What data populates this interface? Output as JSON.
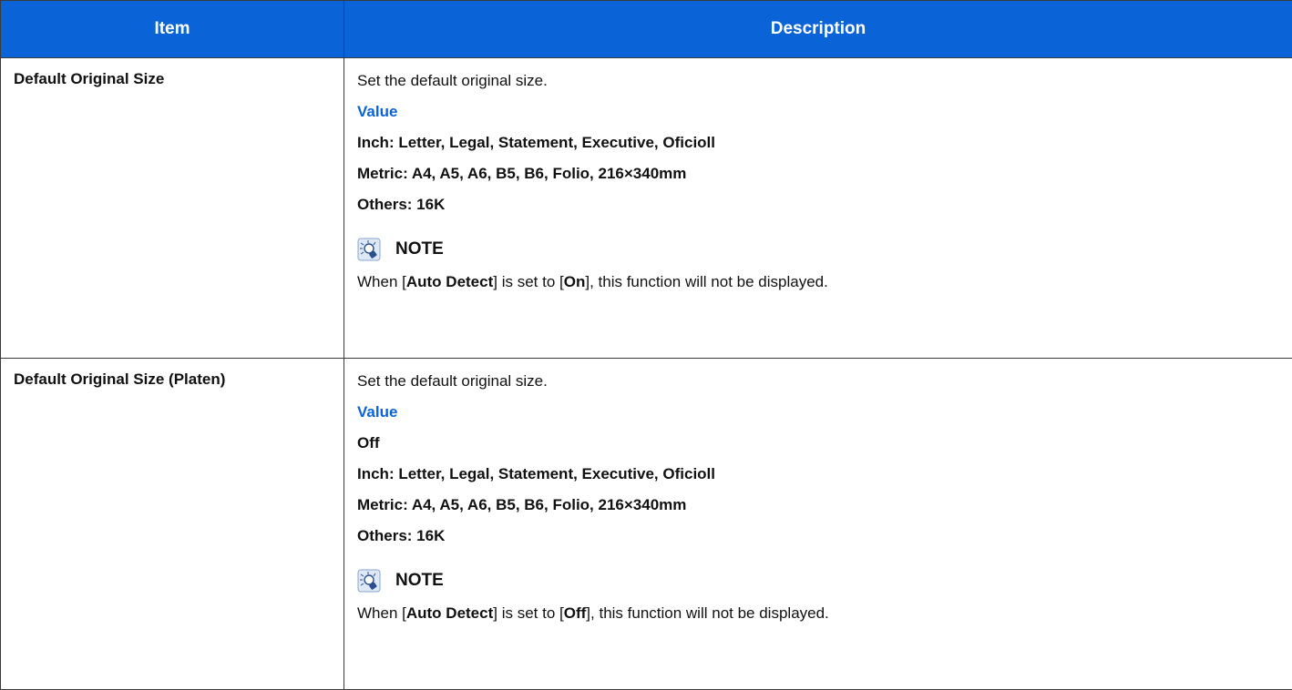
{
  "table": {
    "headers": {
      "item": "Item",
      "description": "Description"
    },
    "rows": [
      {
        "item": "Default Original Size",
        "intro": "Set the default original size.",
        "value_heading": "Value",
        "values": [
          "Inch: Letter, Legal, Statement, Executive, Oficioll",
          "Metric: A4, A5, A6, B5, B6, Folio, 216×340mm",
          "Others: 16K"
        ],
        "note_label": "NOTE",
        "note": {
          "pre": "When [",
          "key": "Auto Detect",
          "mid": "] is set to [",
          "state": "On",
          "post": "], this function will not be displayed."
        }
      },
      {
        "item": "Default Original Size (Platen)",
        "intro": "Set the default original size.",
        "value_heading": "Value",
        "values": [
          "Off",
          "Inch: Letter, Legal, Statement, Executive, Oficioll",
          "Metric: A4, A5, A6, B5, B6, Folio, 216×340mm",
          "Others: 16K"
        ],
        "note_label": "NOTE",
        "note": {
          "pre": "When [",
          "key": "Auto Detect",
          "mid": "] is set to [",
          "state": "Off",
          "post": "], this function will not be displayed."
        }
      }
    ]
  },
  "colors": {
    "header_bg": "#0a64d8",
    "header_text": "#ffffff",
    "value_heading": "#0a64d8",
    "border": "#3a3a3a"
  },
  "icons": {
    "note": "note-lightbulb-icon"
  }
}
